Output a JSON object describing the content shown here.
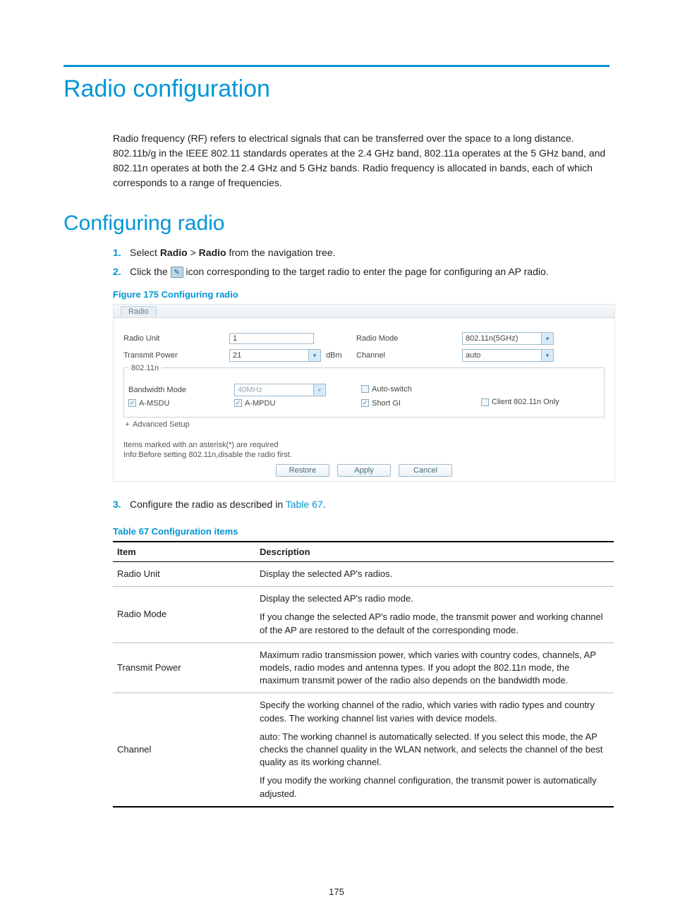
{
  "page": {
    "title": "Radio configuration",
    "intro": "Radio frequency (RF) refers to electrical signals that can be transferred over the space to a long distance. 802.11b/g in the IEEE 802.11 standards operates at the 2.4 GHz band, 802.11a operates at the 5 GHz band, and 802.11n operates at both the 2.4 GHz and 5 GHz bands. Radio frequency is allocated in bands, each of which corresponds to a range of frequencies.",
    "section_title": "Configuring radio",
    "page_number": "175"
  },
  "steps": {
    "s1_pre": "Select ",
    "s1_b1": "Radio",
    "s1_sep": " > ",
    "s1_b2": "Radio",
    "s1_post": " from the navigation tree.",
    "s2_pre": "Click the ",
    "s2_post": " icon corresponding to the target radio to enter the page for configuring an AP radio.",
    "s3_pre": "Configure the radio as described in ",
    "s3_link": "Table 67",
    "s3_post": "."
  },
  "figure": {
    "caption": "Figure 175 Configuring radio",
    "tab": "Radio",
    "labels": {
      "radio_unit": "Radio Unit",
      "radio_mode": "Radio Mode",
      "transmit_power": "Transmit Power",
      "channel": "Channel",
      "dbm": "dBm",
      "fieldset": "802.11n",
      "bandwidth_mode": "Bandwidth Mode",
      "auto_switch": "Auto-switch",
      "amsdu": "A-MSDU",
      "ampdu": "A-MPDU",
      "short_gi": "Short GI",
      "client_only": "Client 802.11n Only",
      "advanced": "Advanced Setup",
      "note1": "Items marked with an asterisk(*) are required",
      "note2": "Info:Before setting 802.11n,disable the radio first.",
      "restore": "Restore",
      "apply": "Apply",
      "cancel": "Cancel"
    },
    "values": {
      "radio_unit": "1",
      "radio_mode": "802.11n(5GHz)",
      "transmit_power": "21",
      "channel": "auto",
      "bandwidth_mode": "40MHz"
    }
  },
  "table": {
    "caption": "Table 67 Configuration items",
    "head_item": "Item",
    "head_desc": "Description",
    "rows": [
      {
        "item": "Radio Unit",
        "desc": "Display the selected AP's radios."
      },
      {
        "item": "Radio Mode",
        "desc_a": "Display the selected AP's radio mode.",
        "desc_b": "If you change the selected AP's radio mode, the transmit power and working channel of the AP are restored to the default of the corresponding mode."
      },
      {
        "item": "Transmit Power",
        "desc": "Maximum radio transmission power, which varies with country codes, channels, AP models, radio modes and antenna types. If you adopt the 802.11n mode, the maximum transmit power of the radio also depends on the bandwidth mode."
      },
      {
        "item": "Channel",
        "desc_a": "Specify the working channel of the radio, which varies with radio types and country codes. The working channel list varies with device models.",
        "desc_b": "auto: The working channel is automatically selected. If you select this mode, the AP checks the channel quality in the WLAN network, and selects the channel of the best quality as its working channel.",
        "desc_c": "If you modify the working channel configuration, the transmit power is automatically adjusted."
      }
    ]
  }
}
